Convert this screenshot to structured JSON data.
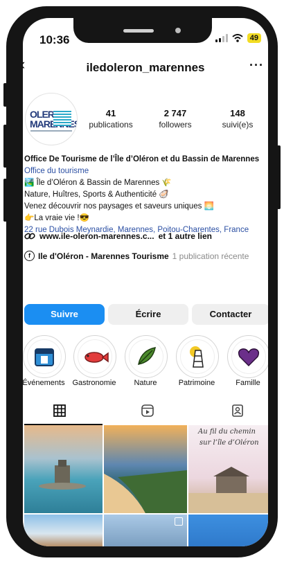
{
  "status_bar": {
    "time": "10:36",
    "battery": "49"
  },
  "header": {
    "username": "iledoleron_marennes"
  },
  "profile": {
    "logo_text_1": "OLERON",
    "logo_text_2": "MARENNES",
    "posts_count": "41",
    "posts_label": "publications",
    "followers_count": "2 747",
    "followers_label": "followers",
    "following_count": "148",
    "following_label": "suivi(e)s"
  },
  "bio": {
    "name": "Office De Tourisme de l’Île d’Oléron et du Bassin de Marennes",
    "category": "Office du tourisme",
    "line1": "🏞️ Île d’Oléron & Bassin de Marennes 🌾",
    "line2": "Nature, Huîtres, Sports & Authenticité 🦪",
    "line3": "Venez découvrir nos paysages et saveurs uniques 🌅",
    "line4": "👉La vraie vie !😎",
    "address": "22 rue Dubois Meynardie, Marennes, Poitou-Charentes, France",
    "link": "www.ile-oleron-marennes.c...",
    "link_extra": "et 1 autre lien",
    "fb_page": "Ile d'Oléron - Marennes Tourisme",
    "fb_recent": "1 publication récente"
  },
  "actions": {
    "follow": "Suivre",
    "message": "Écrire",
    "contact": "Contacter"
  },
  "highlights": [
    {
      "label": "Événements",
      "icon": "calendar-icon"
    },
    {
      "label": "Gastronomie",
      "icon": "fish-icon"
    },
    {
      "label": "Nature",
      "icon": "leaf-icon"
    },
    {
      "label": "Patrimoine",
      "icon": "lighthouse-icon"
    },
    {
      "label": "Famille",
      "icon": "heart-icon"
    }
  ],
  "grid": {
    "tile3_text_1": "Au fil du chemin",
    "tile3_text_2": "sur l’île d’Oléron"
  },
  "colors": {
    "accent": "#1b8ef2",
    "link": "#2b4fa3"
  }
}
